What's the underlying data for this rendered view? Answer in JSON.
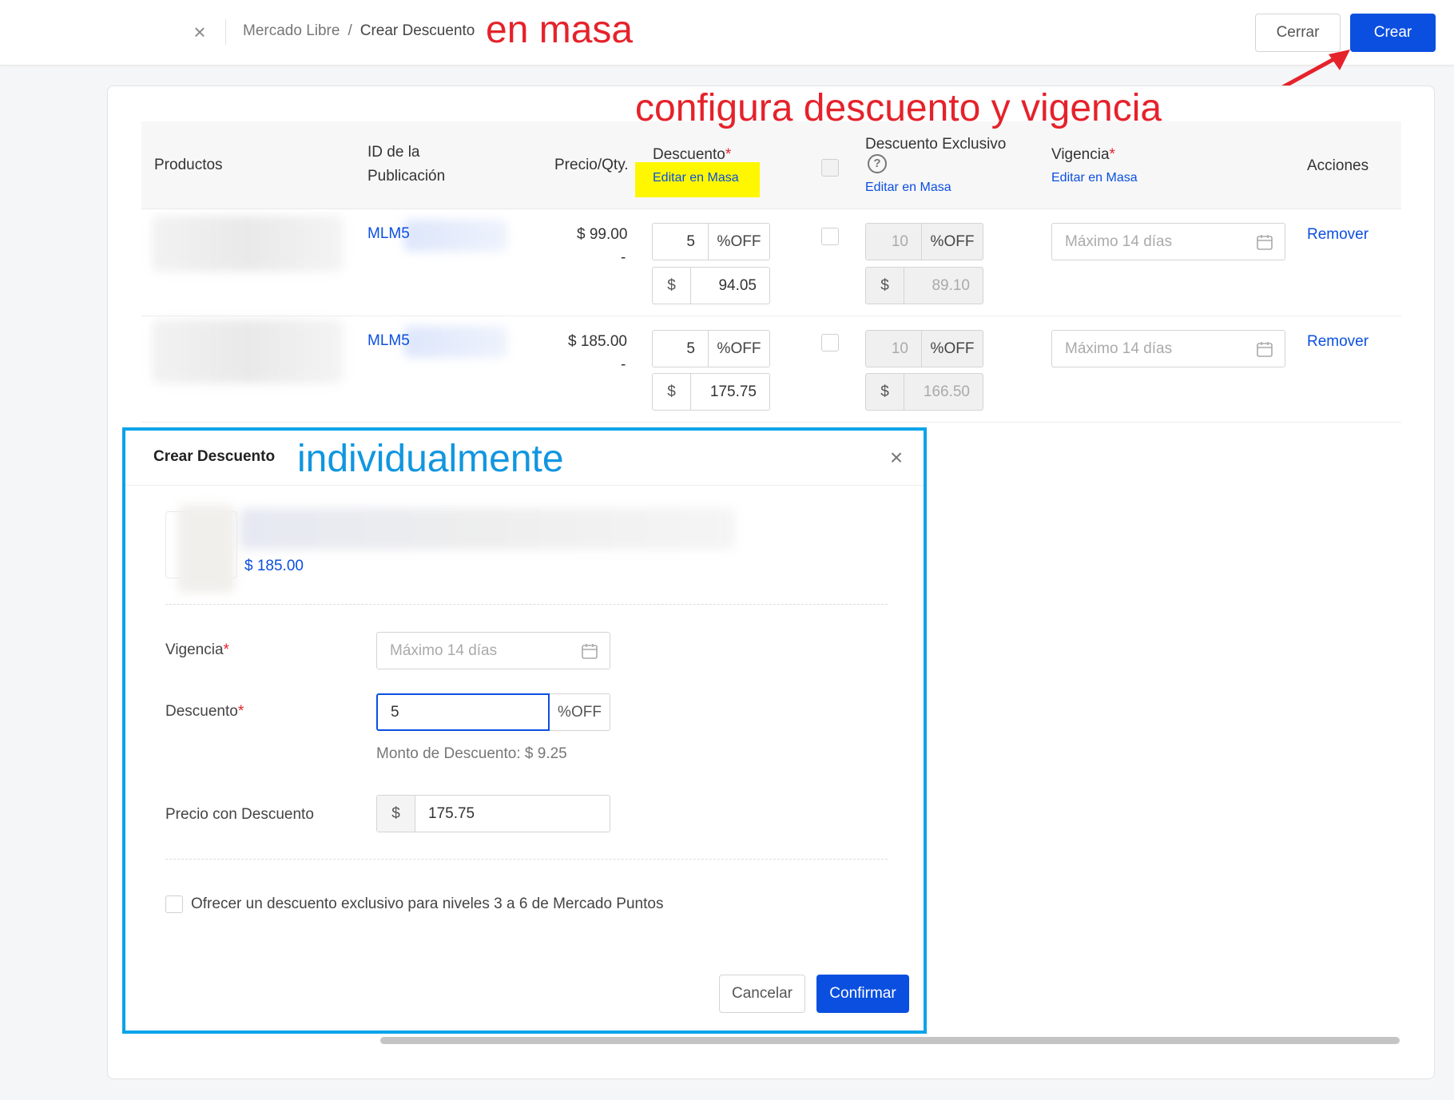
{
  "header": {
    "breadcrumb": [
      "Mercado Libre",
      "/",
      "Crear Descuento"
    ],
    "close_button": "Cerrar",
    "create_button": "Crear"
  },
  "annotations": {
    "bulk": "en masa",
    "configure": "configura descuento y vigencia",
    "individual": "individualmente"
  },
  "table": {
    "headers": {
      "products": "Productos",
      "pub_id_line1": "ID de la",
      "pub_id_line2": "Publicación",
      "price_qty": "Precio/Qty.",
      "discount": "Descuento",
      "discount_mass": "Editar en Masa",
      "exclusive": "Descuento Exclusivo",
      "exclusive_mass": "Editar en Masa",
      "validity": "Vigencia",
      "validity_mass": "Editar en Masa",
      "actions": "Acciones"
    },
    "rows": [
      {
        "pub_id": "MLM5",
        "price": "$ 99.00",
        "qty": "-",
        "discount_pct": "5",
        "discount_suffix": "%OFF",
        "discount_currency": "$",
        "discount_price": "94.05",
        "exclusive_pct": "10",
        "exclusive_suffix": "%OFF",
        "exclusive_currency": "$",
        "exclusive_price": "89.10",
        "validity_placeholder": "Máximo 14 días",
        "action": "Remover"
      },
      {
        "pub_id": "MLM5",
        "price": "$ 185.00",
        "qty": "-",
        "discount_pct": "5",
        "discount_suffix": "%OFF",
        "discount_currency": "$",
        "discount_price": "175.75",
        "exclusive_pct": "10",
        "exclusive_suffix": "%OFF",
        "exclusive_currency": "$",
        "exclusive_price": "166.50",
        "validity_placeholder": "Máximo 14 días",
        "action": "Remover"
      }
    ]
  },
  "modal": {
    "title": "Crear Descuento",
    "product_price": "$ 185.00",
    "validity_label": "Vigencia",
    "validity_placeholder": "Máximo 14 días",
    "discount_label": "Descuento",
    "discount_value": "5",
    "discount_suffix": "%OFF",
    "discount_amount": "Monto de Descuento: $ 9.25",
    "price_label": "Precio con Descuento",
    "price_currency": "$",
    "price_value": "175.75",
    "exclusive_checkbox": "Ofrecer un descuento exclusivo para niveles 3 a 6 de Mercado Puntos",
    "cancel": "Cancelar",
    "confirm": "Confirmar"
  },
  "colors": {
    "primary": "#0b4fe0",
    "annotation_red": "#e5222b",
    "annotation_blue": "#1196e0",
    "highlight": "#fff700"
  },
  "icons": [
    "close-icon",
    "calendar-icon",
    "help-icon",
    "arrow-annotation"
  ]
}
